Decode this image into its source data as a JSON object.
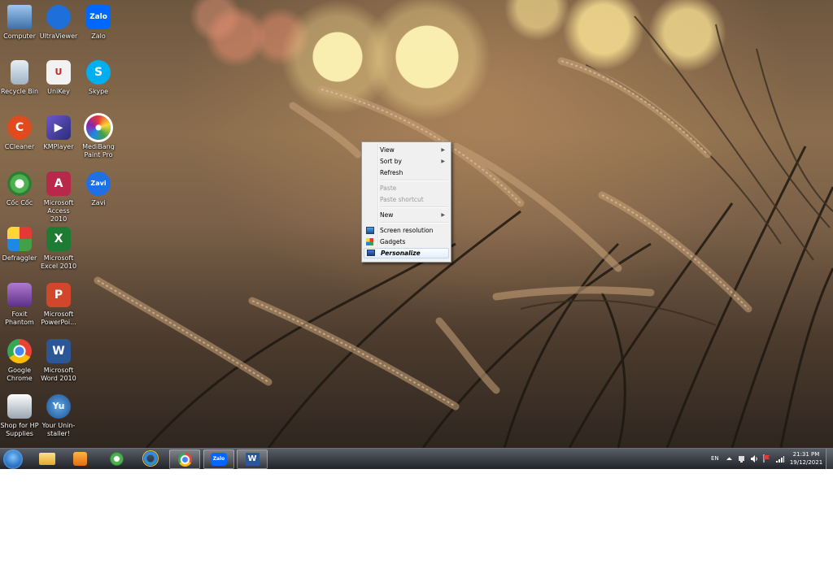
{
  "desktop_icons": [
    {
      "label": "Computer"
    },
    {
      "label": "UltraViewer"
    },
    {
      "label": "Zalo",
      "glyph": "Zalo"
    },
    {
      "label": "Recycle Bin"
    },
    {
      "label": "UniKey",
      "glyph": "U"
    },
    {
      "label": "Skype",
      "glyph": "S"
    },
    {
      "label": "CCleaner",
      "glyph": "C"
    },
    {
      "label": "KMPlayer",
      "glyph": "▶"
    },
    {
      "label": "MediBang Paint Pro"
    },
    {
      "label": "Cốc Cốc"
    },
    {
      "label": "Microsoft Access 2010",
      "glyph": "A"
    },
    {
      "label": "Zavi",
      "glyph": "Zavi"
    },
    {
      "label": "Defraggler"
    },
    {
      "label": "Microsoft Excel 2010",
      "glyph": "X"
    },
    {
      "label": "Foxit Phantom"
    },
    {
      "label": "Microsoft PowerPoi...",
      "glyph": "P"
    },
    {
      "label": "Google Chrome"
    },
    {
      "label": "Microsoft Word 2010",
      "glyph": "W"
    },
    {
      "label": "Shop for HP Supplies"
    },
    {
      "label": "Your Unin-staller!",
      "glyph": "Yu"
    }
  ],
  "context_menu": {
    "items": [
      {
        "label": "View",
        "submenu": "▶"
      },
      {
        "label": "Sort by",
        "submenu": "▶"
      },
      {
        "label": "Refresh"
      },
      {
        "label": "Paste"
      },
      {
        "label": "Paste shortcut"
      },
      {
        "label": "New",
        "submenu": "▶"
      },
      {
        "label": "Screen resolution"
      },
      {
        "label": "Gadgets"
      },
      {
        "label": "Personalize"
      }
    ]
  },
  "taskbar": {
    "zalo_glyph": "Zalo",
    "word_glyph": "W",
    "language": "EN",
    "time": "21:31 PM",
    "date": "19/12/2021"
  },
  "colors": {
    "taskbar": "#1c1e24",
    "menu_bg": "#f0f0f0",
    "menu_highlight": "#e2eefc"
  }
}
